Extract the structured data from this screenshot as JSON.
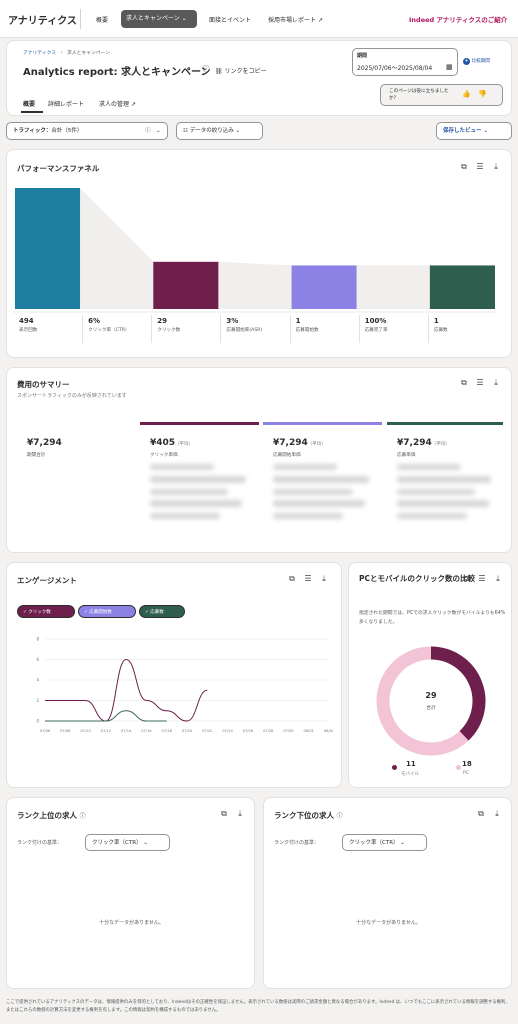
{
  "topnav": {
    "brand": "アナリティクス",
    "items": [
      "概要",
      "求人とキャンペーン",
      "面接とイベント",
      "採用市場レポート"
    ],
    "promo": "Indeed アナリティクスのご紹介"
  },
  "header": {
    "breadcrumb": [
      "アナリティクス",
      "求人とキャンペーン"
    ],
    "title": "Analytics report: 求人とキャンペーン",
    "copy_link": "リンクをコピー",
    "period_label": "期間",
    "period_value": "2025/07/06～2025/08/04",
    "compare": "比較期間",
    "tabs": [
      "概要",
      "詳細レポート",
      "求人の管理"
    ],
    "feedback": "このページは役に立ちましたか？"
  },
  "filters": {
    "traffic_label": "トラフィック：",
    "traffic_value": "合計（5件）",
    "narrow": "データの絞り込み",
    "saved_view": "保存したビュー"
  },
  "funnel": {
    "title": "パフォーマンスファネル",
    "metrics": [
      {
        "value": "494",
        "label": "表示回数"
      },
      {
        "value": "6%",
        "label": "クリック率（CTR）"
      },
      {
        "value": "29",
        "label": "クリック数"
      },
      {
        "value": "3%",
        "label": "応募開始率(ASR)"
      },
      {
        "value": "1",
        "label": "応募開始数"
      },
      {
        "value": "100%",
        "label": "応募完了率"
      },
      {
        "value": "1",
        "label": "応募数"
      }
    ],
    "bar_fraction": [
      1.0,
      0.39,
      0.36,
      0.36
    ],
    "colors": [
      "#1f7fa3",
      "#6e1f4b",
      "#8c82e6",
      "#2e5e4e"
    ]
  },
  "cost": {
    "title": "費用のサマリー",
    "subtitle": "スポンサートラフィックのみが反映されています",
    "total_value": "¥7,294",
    "total_label": "期間合計",
    "items": [
      {
        "value": "¥405",
        "suffix": "（平均）",
        "label": "クリック単価",
        "color": "#6e1f4b"
      },
      {
        "value": "¥7,294",
        "suffix": "（平均）",
        "label": "応募開始単価",
        "color": "#8c82e6"
      },
      {
        "value": "¥7,294",
        "suffix": "（平均）",
        "label": "応募単価",
        "color": "#2e5e4e"
      }
    ]
  },
  "engagement": {
    "title": "エンゲージメント",
    "chips": [
      "クリック数",
      "応募開始数",
      "応募数"
    ],
    "chart_data": {
      "type": "line",
      "x": [
        "07/06",
        "07/08",
        "07/10",
        "07/12",
        "07/14",
        "07/16",
        "07/18",
        "07/20",
        "07/22",
        "07/24",
        "07/26",
        "07/28",
        "07/30",
        "08/01",
        "08/04"
      ],
      "ylim": [
        0,
        8
      ],
      "yticks": [
        "8",
        "6",
        "4",
        "2",
        "0"
      ],
      "series": [
        {
          "name": "クリック数",
          "color": "#6e1f4b",
          "values": [
            2,
            2,
            2,
            0,
            6,
            2,
            1,
            0,
            3,
            0,
            0,
            0,
            0,
            0,
            0
          ]
        },
        {
          "name": "応募開始数",
          "color": "#3d6b59",
          "values": [
            0,
            0,
            0,
            0,
            1,
            0,
            0,
            0,
            0,
            0,
            0,
            0,
            0,
            0,
            0
          ]
        }
      ]
    }
  },
  "device": {
    "title": "PCとモバイルのクリック数の比較",
    "desc": "指定された期間では、PCでの求人クリック数がモバイルよりも64%多くなりました。",
    "total_value": "29",
    "total_label": "合計",
    "chart_data": {
      "type": "pie",
      "slices": [
        {
          "name": "モバイル",
          "value": 11,
          "color": "#6e1f4b"
        },
        {
          "name": "PC",
          "value": 18,
          "color": "#f2c4d6"
        }
      ]
    }
  },
  "top_jobs": {
    "title": "ランク上位の求人",
    "rank_label": "ランク付けの基準：",
    "rank_value": "クリック率（CTR）",
    "empty": "十分なデータがありません。"
  },
  "bottom_jobs": {
    "title": "ランク下位の求人",
    "rank_label": "ランク付けの基準：",
    "rank_value": "クリック率（CTR）",
    "empty": "十分なデータがありません。"
  },
  "footer": {
    "text": "ここで提供されているアナリティクスのデータは、情報提供のみを目的としており、Indeedはその正確性を保証しません。表示されている数値は実際のご請求金額と異なる場合があります。Indeed は、いつでもここに表示されている情報を調整する権利、またはこれらの数値の計算方法を変更する権利を有します。この情報は契約を構成するものではありません。"
  }
}
